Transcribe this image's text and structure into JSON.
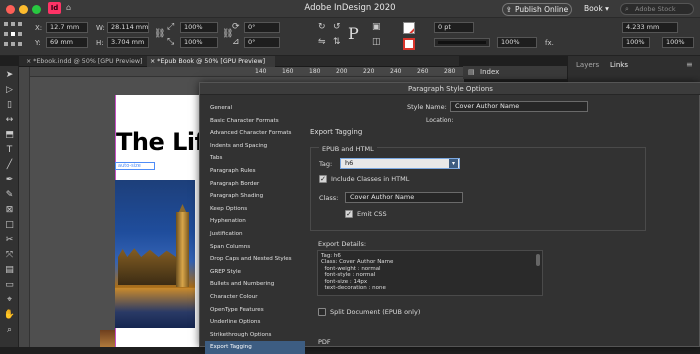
{
  "titlebar": {
    "title": "Adobe InDesign 2020",
    "publish_label": "Publish Online",
    "workspace": "Book",
    "search_placeholder": "Adobe Stock"
  },
  "control": {
    "x_label": "X:",
    "x_value": "12.7 mm",
    "y_label": "Y:",
    "y_value": "69 mm",
    "w_label": "W:",
    "w_value": "28.114 mm",
    "h_label": "H:",
    "h_value": "3.704 mm",
    "scale_x": "100%",
    "scale_y": "100%",
    "angle": "0°",
    "shear": "0°",
    "stroke_weight": "0 pt",
    "opacity": "100%",
    "fx_label": "fx.",
    "ref_width": "4.233 mm",
    "zoom_a": "100%",
    "zoom_b": "100%"
  },
  "doc_tabs": [
    "*Ebook.indd @ 50% [GPU Preview]",
    "*Epub Book @ 50% [GPU Preview]"
  ],
  "ruler": [
    "140",
    "160",
    "180",
    "200",
    "220",
    "240",
    "260",
    "280"
  ],
  "panels": {
    "index": "Index",
    "layers": "Layers",
    "links": "Links"
  },
  "canvas": {
    "heading": "The Life",
    "frame_label": "auto-size"
  },
  "dialog": {
    "title": "Paragraph Style Options",
    "style_name_label": "Style Name:",
    "style_name_value": "Cover Author Name",
    "location_label": "Location:",
    "section_title": "Export Tagging",
    "epub_title": "EPUB and HTML",
    "tag_label": "Tag:",
    "tag_value": "h6",
    "include_classes_label": "Include Classes in HTML",
    "class_label": "Class:",
    "class_value": "Cover Author Name",
    "emit_css_label": "Emit CSS",
    "export_details_label": "Export Details:",
    "details_text": "Tag: h6\nClass: Cover Author Name\n  font-weight : normal\n  font-style : normal\n  font-size : 14px\n  text-decoration : none",
    "split_document_label": "Split Document (EPUB only)",
    "pdf_label": "PDF",
    "categories": [
      "General",
      "Basic Character Formats",
      "Advanced Character Formats",
      "Indents and Spacing",
      "Tabs",
      "Paragraph Rules",
      "Paragraph Border",
      "Paragraph Shading",
      "Keep Options",
      "Hyphenation",
      "Justification",
      "Span Columns",
      "Drop Caps and Nested Styles",
      "GREP Style",
      "Bullets and Numbering",
      "Character Colour",
      "OpenType Features",
      "Underline Options",
      "Strikethrough Options",
      "Export Tagging"
    ],
    "selected_category": "Export Tagging"
  },
  "colors": {
    "selection": "#3d5d82",
    "accent_red": "#d9342b",
    "frame_blue": "#4e8cf7"
  }
}
